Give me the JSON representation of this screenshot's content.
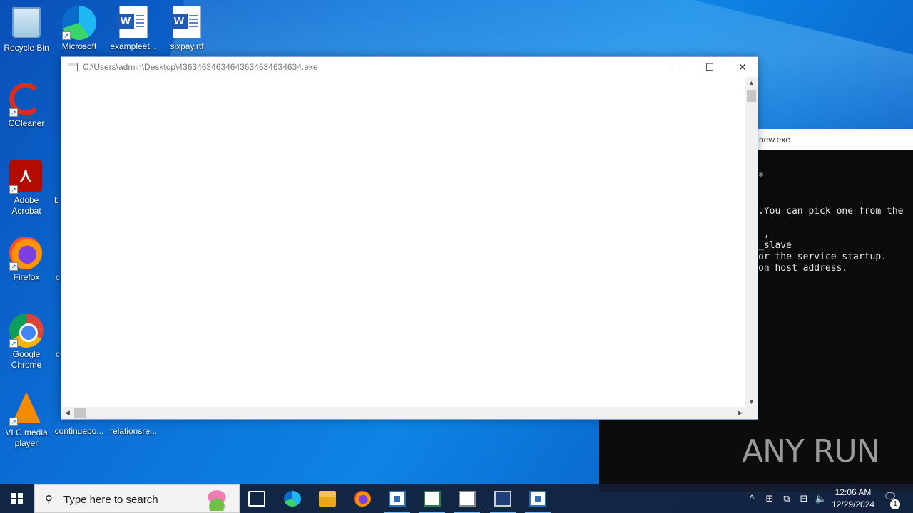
{
  "desktop": {
    "icons": [
      {
        "label": "Recycle Bin",
        "icon": "recycle-bin-icon"
      },
      {
        "label": "Microsoft Edge",
        "icon": "edge-icon"
      },
      {
        "label": "exampleet...",
        "icon": "word-doc-icon"
      },
      {
        "label": "sixpay.rtf",
        "icon": "word-doc-icon"
      },
      {
        "label": "CCleaner",
        "icon": "ccleaner-icon"
      },
      {
        "label": "Adobe Acrobat",
        "icon": "acrobat-icon"
      },
      {
        "label": "Firefox",
        "icon": "firefox-icon"
      },
      {
        "label": "Google Chrome",
        "icon": "chrome-icon"
      },
      {
        "label": "VLC media player",
        "icon": "vlc-icon"
      },
      {
        "label": "continuepo...",
        "icon": "file-icon"
      },
      {
        "label": "relationsre...",
        "icon": "file-icon"
      }
    ],
    "partial_labels": [
      "b",
      "c",
      "c"
    ]
  },
  "main_window": {
    "title": "C:\\Users\\admin\\Desktop\\43634634634643634634634634.exe",
    "controls": {
      "minimize": "—",
      "maximize": "☐",
      "close": "✕"
    }
  },
  "console_window": {
    "title_partial": "new.exe",
    "lines": [
      "*",
      "",
      "",
      ".You can pick one from the",
      "",
      " ,",
      "_slave",
      "or the service startup.",
      "on host address."
    ]
  },
  "watermark": "ANY RUN",
  "taskbar": {
    "search_placeholder": "Type here to search",
    "apps": [
      "task-view-icon",
      "edge-icon",
      "file-explorer-icon",
      "firefox-icon",
      "app-window-icon",
      "app-window-icon",
      "certificate-icon",
      "cmd-icon",
      "app-window-icon"
    ],
    "tray_chevron": "^",
    "clock_time": "12:06 AM",
    "clock_date": "12/29/2024",
    "notification_count": "1"
  }
}
